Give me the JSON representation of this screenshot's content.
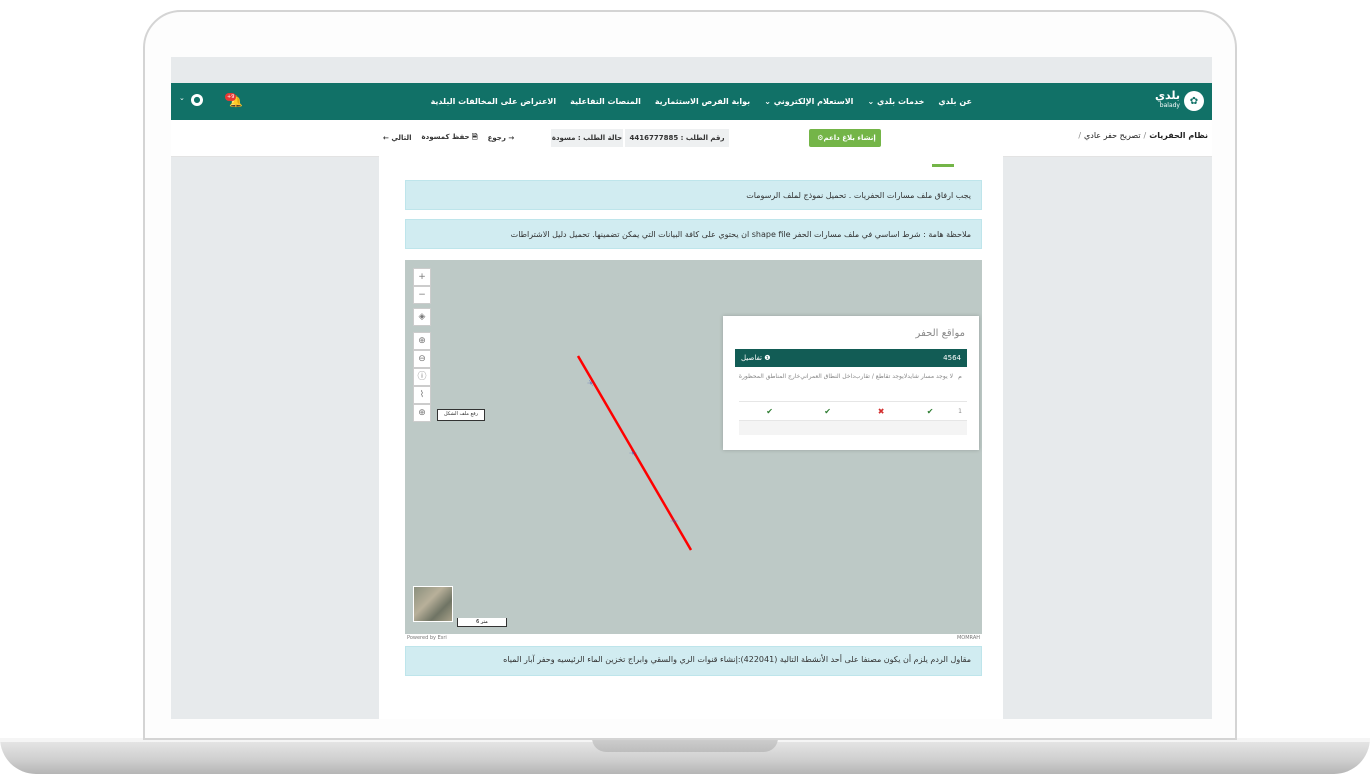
{
  "header": {
    "logo_text": "بلدي",
    "logo_sub": "balady",
    "nav": [
      "عن بلدي",
      "خدمات بلدي",
      "الاستعلام الإلكتروني",
      "بوابة الفرص الاستثمارية",
      "المنصات التفاعلية",
      "الاعتراض على المخالفات البلدية"
    ],
    "notification_count": "+9"
  },
  "subbar": {
    "system": "نظام الحفريات",
    "page": "تصريح حفر عادي",
    "report_button": "إنشاء بلاغ داعم",
    "request_number": "رقم الطلب : 4416777885",
    "request_status": "حالة الطلب : مسودة",
    "back": "رجوع",
    "save_draft": "حفظ كمسودة",
    "next": "التالي"
  },
  "alerts": {
    "a1": "يجب ارفاق ملف مسارات الحفريات . تحميل نموذج لملف الرسومات",
    "a2": "ملاحظة هامة : شرط اساسي في ملف مسارات الحفر shape file ان يحتوي على كافة البيانات التي يمكن تضمينها. تحميل دليل الاشتراطات",
    "a3": "مقاول الردم يلزم أن يكون مصنفا على أحد الأنشطة التالية (422041):إنشاء قنوات الري والسقي وابراج تخزين الماء الرئيسيه وحفر آبار المياه"
  },
  "map": {
    "tooltip": "رفع ملف الشكل",
    "scale_label": "6 متر",
    "powered": "Powered by Esri",
    "provider": "MOMRAH"
  },
  "panel": {
    "title": "مواقع الحفر",
    "id": "4564",
    "details": "تفاصيل",
    "columns": [
      "م",
      "لا يوجد مسار شايد",
      "لايوجد تقاطع / تقارب",
      "داخل النطاق العمراني",
      "خارج المناطق المحظورة"
    ],
    "row": {
      "index": "1"
    }
  },
  "colors": {
    "primary": "#117167",
    "accent": "#74b548",
    "route": "#ff0000"
  }
}
